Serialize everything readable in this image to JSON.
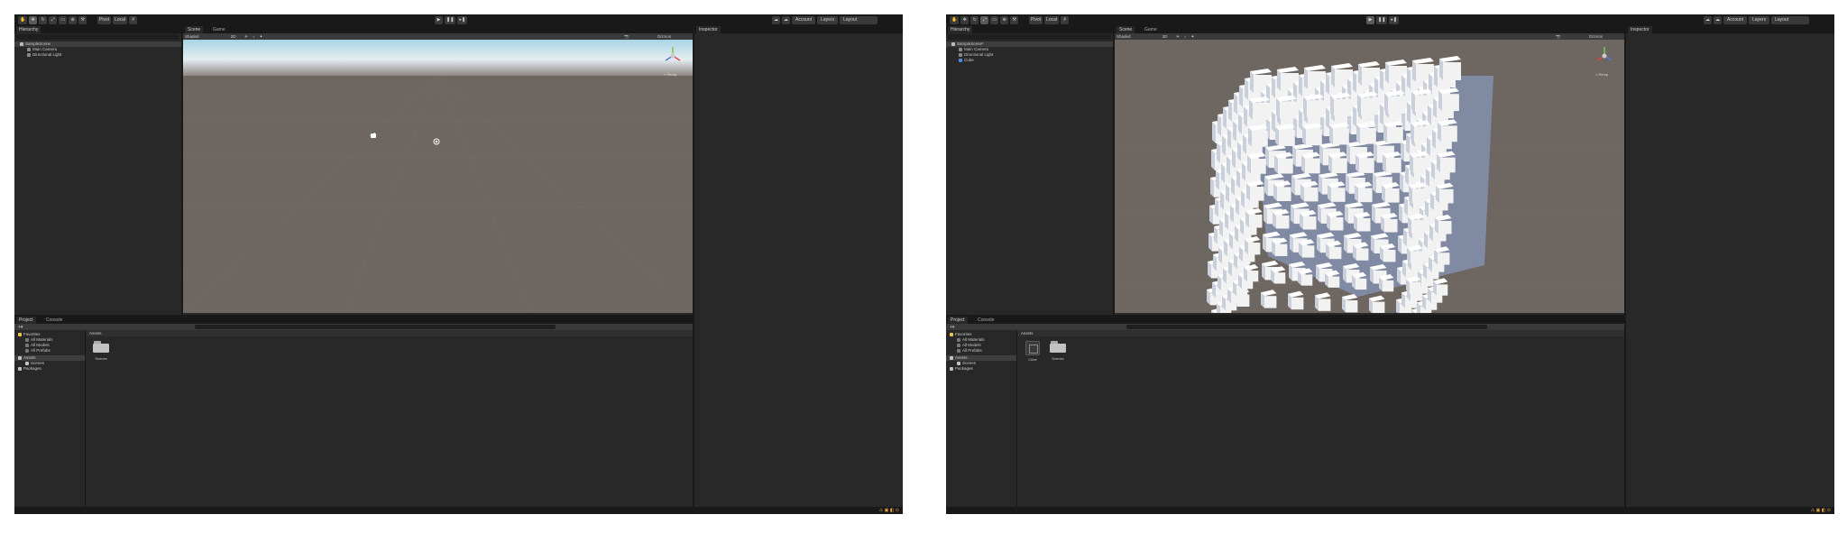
{
  "toolbar": {
    "pivot": "Pivot",
    "local": "Local",
    "account": "Account",
    "layers": "Layers",
    "layout": "Layout"
  },
  "tabs": {
    "hierarchy": "Hierarchy",
    "scene": "Scene",
    "game": "Game",
    "inspector": "Inspector",
    "project": "Project",
    "console": "Console"
  },
  "scene_toolbar": {
    "shading": "Shaded",
    "mode2d": "2D",
    "gizmos": "Gizmos"
  },
  "persp_label": "< Persp",
  "left": {
    "hierarchy_items": [
      "SampleScene",
      "Main Camera",
      "Directional Light"
    ]
  },
  "right": {
    "hierarchy_items": [
      "SampleScene*",
      "Main Camera",
      "Directional Light",
      "Cube"
    ]
  },
  "project": {
    "favorites": "Favorites",
    "favorite_items": [
      "All Materials",
      "All Models",
      "All Prefabs"
    ],
    "assets": "Assets",
    "asset_children": [
      "Scenes"
    ],
    "packages": "Packages",
    "breadcrumb": "Assets"
  },
  "left_assets": [
    "Scenes"
  ],
  "right_assets": [
    "Cube",
    "Scenes"
  ],
  "colors": {
    "editor_bg": "#191919",
    "panel_bg": "#282828",
    "sky_top": "#a9d3e4",
    "ground": "#6e6660",
    "cube_face": "#f2f2f2",
    "cube_blue": "#8fa8d8"
  }
}
